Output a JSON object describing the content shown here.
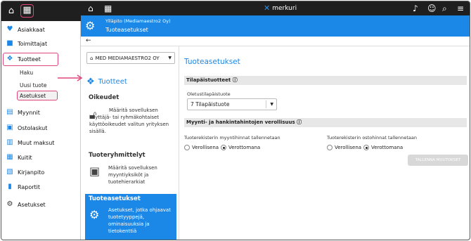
{
  "nav": {
    "items": [
      {
        "label": "Asiakkaat",
        "icon": "heart-icon"
      },
      {
        "label": "Toimittajat",
        "icon": "truck-icon"
      },
      {
        "label": "Tuotteet",
        "icon": "dropbox-icon"
      },
      {
        "label": "Myynnit",
        "icon": "invoice-icon"
      },
      {
        "label": "Ostolaskut",
        "icon": "wallet-icon"
      },
      {
        "label": "Muut maksut",
        "icon": "money-icon"
      },
      {
        "label": "Kuitit",
        "icon": "receipt-icon"
      },
      {
        "label": "Kirjanpito",
        "icon": "ledger-icon"
      },
      {
        "label": "Raportit",
        "icon": "report-icon"
      },
      {
        "label": "Asetukset",
        "icon": "gears-icon"
      }
    ],
    "sub_items": [
      "Haku",
      "Uusi tuote",
      "Asetukset"
    ]
  },
  "topbar": {
    "logo": "merkuri"
  },
  "header": {
    "company": "Ylläpito (Mediamaestro2 Oy)",
    "title": "Tuoteasetukset"
  },
  "module": {
    "company_select": "MED MEDIAMAESTRO2 OY",
    "title": "Tuotteet",
    "sections": [
      {
        "title": "Oikeudet",
        "desc": "Määritä sovelluksen käyttäjä- tai ryhmäkohtaiset käyttöoikeudet valitun yrityksen sisällä."
      },
      {
        "title": "Tuoteryhmittelyt",
        "desc": "Määritä sovelluksen myyntiyksiköt ja tuotehierarkiat"
      },
      {
        "title": "Tuoteasetukset",
        "desc": "Asetukset, jotka ohjaavat tuotetyyppejä, ominaisuuksia ja tietokenttiä"
      }
    ]
  },
  "content": {
    "title": "Tuoteasetukset",
    "band1": "Tilapäistuotteet",
    "default_label": "Oletustilapäistuote",
    "default_value": "7 Tilapäistuote",
    "band2": "Myynti- ja hankintahintojen verollisuus",
    "sales_label": "Tuoterekisterin myyntihinnat tallennetaan",
    "purchase_label": "Tuoterekisterin ostohinnat tallennetaan",
    "opt_gross": "Verollisena",
    "opt_net": "Verottomana",
    "sales_selected": "Verottomana",
    "purchase_selected": "Verottomana",
    "save_label": "TALLENNA MUUTOKSET"
  },
  "colors": {
    "accent": "#1b87e6",
    "highlight": "#e0457b",
    "dark": "#1f1f1f"
  }
}
